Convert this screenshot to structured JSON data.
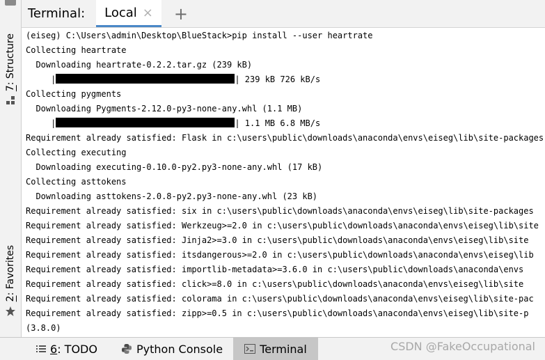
{
  "left_toolbar": {
    "structure": {
      "key": "7",
      "label": ": Structure"
    },
    "favorites": {
      "key": "2",
      "label": ": Favorites"
    }
  },
  "tab_header": {
    "title": "Terminal:",
    "active_tab": "Local",
    "close_symbol": "×",
    "add_symbol": "+"
  },
  "terminal": {
    "lines": [
      "(eiseg) C:\\Users\\admin\\Desktop\\BlueStack>pip install --user heartrate",
      "Collecting heartrate",
      "  Downloading heartrate-0.2.2.tar.gz (239 kB)",
      {
        "pre": "     |",
        "post": "| 239 kB 726 kB/s",
        "progress": 1.0
      },
      "Collecting pygments",
      "  Downloading Pygments-2.12.0-py3-none-any.whl (1.1 MB)",
      {
        "pre": "     |",
        "post": "| 1.1 MB 6.8 MB/s",
        "progress": 1.0
      },
      "Requirement already satisfied: Flask in c:\\users\\public\\downloads\\anaconda\\envs\\eiseg\\lib\\site-packages",
      "Collecting executing",
      "  Downloading executing-0.10.0-py2.py3-none-any.whl (17 kB)",
      "Collecting asttokens",
      "  Downloading asttokens-2.0.8-py2.py3-none-any.whl (23 kB)",
      "Requirement already satisfied: six in c:\\users\\public\\downloads\\anaconda\\envs\\eiseg\\lib\\site-packages",
      "Requirement already satisfied: Werkzeug>=2.0 in c:\\users\\public\\downloads\\anaconda\\envs\\eiseg\\lib\\site",
      "Requirement already satisfied: Jinja2>=3.0 in c:\\users\\public\\downloads\\anaconda\\envs\\eiseg\\lib\\site",
      "Requirement already satisfied: itsdangerous>=2.0 in c:\\users\\public\\downloads\\anaconda\\envs\\eiseg\\lib",
      "Requirement already satisfied: importlib-metadata>=3.6.0 in c:\\users\\public\\downloads\\anaconda\\envs",
      "Requirement already satisfied: click>=8.0 in c:\\users\\public\\downloads\\anaconda\\envs\\eiseg\\lib\\site",
      "Requirement already satisfied: colorama in c:\\users\\public\\downloads\\anaconda\\envs\\eiseg\\lib\\site-pac",
      "Requirement already satisfied: zipp>=0.5 in c:\\users\\public\\downloads\\anaconda\\envs\\eiseg\\lib\\site-p",
      "(3.8.0)"
    ]
  },
  "bottom_bar": {
    "todo": {
      "key": "6",
      "label": ": TODO"
    },
    "python_console": "Python Console",
    "terminal": "Terminal"
  },
  "watermark": "CSDN @FakeOccupational",
  "colors": {
    "active_tab_underline": "#4a88c7",
    "active_bottom_tab": "#c6c6c6"
  }
}
